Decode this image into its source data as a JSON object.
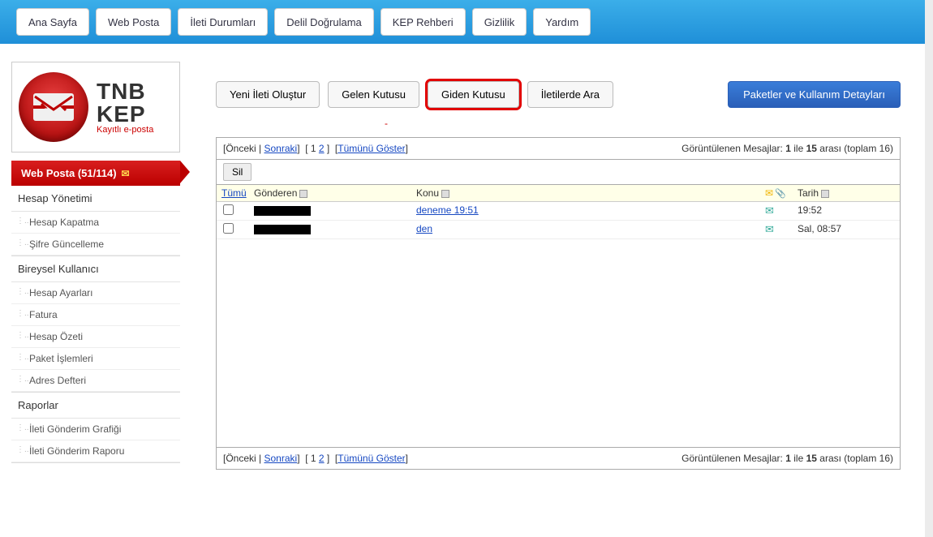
{
  "topnav": {
    "home": "Ana Sayfa",
    "webmail": "Web Posta",
    "status": "İleti Durumları",
    "verify": "Delil Doğrulama",
    "guide": "KEP Rehberi",
    "privacy": "Gizlilik",
    "help": "Yardım"
  },
  "logo": {
    "line1": "TNB",
    "line2": "KEP",
    "tag": "Kayıtlı e-posta"
  },
  "sidebar": {
    "active": "Web Posta (51/114)",
    "account": {
      "title": "Hesap Yönetimi",
      "close": "Hesap Kapatma",
      "pwd": "Şifre Güncelleme"
    },
    "user": {
      "title": "Bireysel Kullanıcı",
      "settings": "Hesap Ayarları",
      "invoice": "Fatura",
      "summary": "Hesap Özeti",
      "packages": "Paket İşlemleri",
      "addr": "Adres Defteri"
    },
    "reports": {
      "title": "Raporlar",
      "chart": "İleti Gönderim Grafiği",
      "report": "İleti Gönderim Raporu"
    }
  },
  "toolbar": {
    "compose": "Yeni İleti Oluştur",
    "inbox": "Gelen Kutusu",
    "outbox": "Giden Kutusu",
    "search": "İletilerde Ara",
    "packages": "Paketler ve Kullanım Detayları"
  },
  "pager": {
    "prev": "Önceki",
    "next": "Sonraki",
    "p1": "1",
    "p2": "2",
    "showall": "Tümünü Göster",
    "info_pre": "Görüntülenen Mesajlar: ",
    "info_a": "1",
    "info_mid": " ile ",
    "info_b": "15",
    "info_post": " arası (toplam 16)",
    "delete": "Sil"
  },
  "headers": {
    "all": "Tümü",
    "from": "Gönderen",
    "subject": "Konu",
    "date": "Tarih"
  },
  "rows": [
    {
      "subject": "deneme 19:51",
      "date": "19:52"
    },
    {
      "subject": "den",
      "date": "Sal, 08:57"
    }
  ]
}
